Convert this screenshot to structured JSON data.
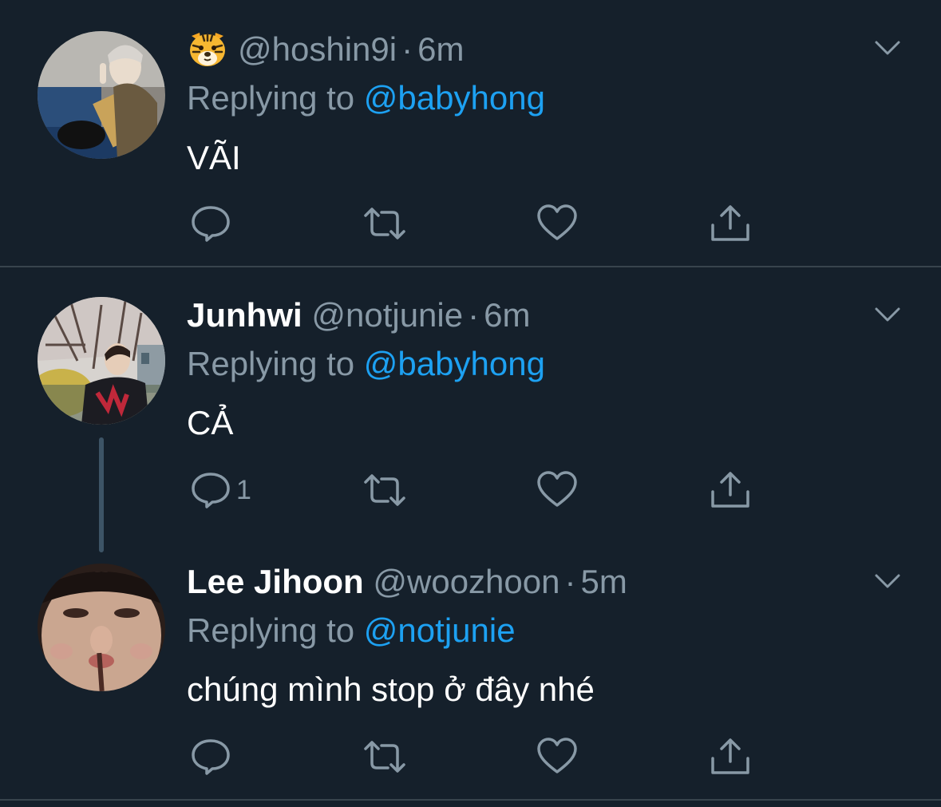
{
  "tweets": [
    {
      "display_name": "",
      "display_name_emoji": "tiger-face-emoji",
      "handle": "@hoshin9i",
      "separator": "·",
      "time": "6m",
      "replying_prefix": "Replying to",
      "replying_to": "@babyhong",
      "text": "VÃI",
      "reply_count": "",
      "avatar": "avatar-hoshin9i"
    },
    {
      "display_name": "Junhwi",
      "handle": "@notjunie",
      "separator": "·",
      "time": "6m",
      "replying_prefix": "Replying to",
      "replying_to": "@babyhong",
      "text": "CẢ",
      "reply_count": "1",
      "avatar": "avatar-notjunie"
    },
    {
      "display_name": "Lee Jihoon",
      "handle": "@woozhoon",
      "separator": "·",
      "time": "5m",
      "replying_prefix": "Replying to",
      "replying_to": "@notjunie",
      "text": "chúng mình stop ở đây nhé",
      "reply_count": "",
      "avatar": "avatar-woozhoon"
    }
  ],
  "icons": {
    "reply": "reply-icon",
    "retweet": "retweet-icon",
    "like": "like-icon",
    "share": "share-icon",
    "more": "chevron-down-icon"
  },
  "colors": {
    "background": "#15202b",
    "text": "#ffffff",
    "secondary": "#8899a6",
    "accent": "#1da1f2",
    "divider": "#38444d",
    "thread_line": "#3d5466"
  }
}
